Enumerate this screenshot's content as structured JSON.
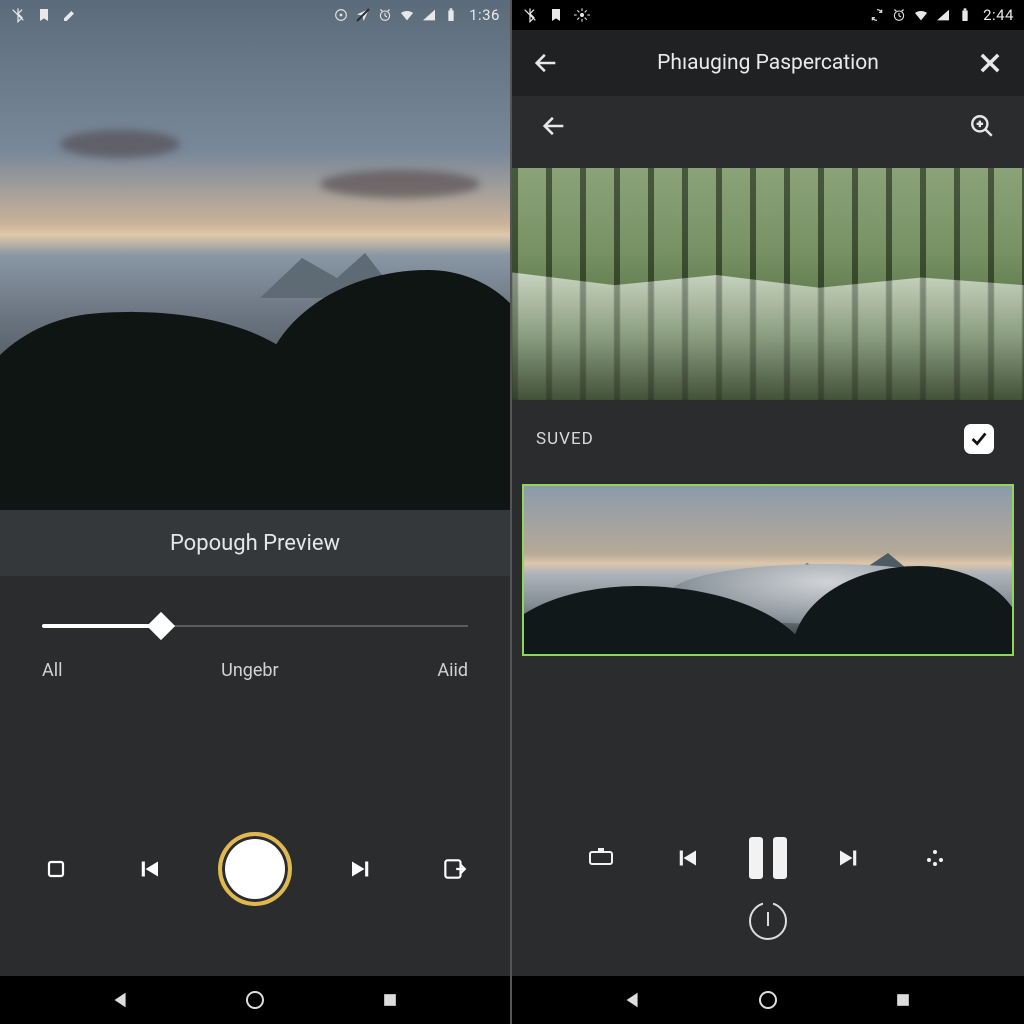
{
  "left": {
    "status": {
      "time": "1:36"
    },
    "panel_title": "Popough Preview",
    "slider": {
      "value_percent": 28,
      "labels": {
        "start": "All",
        "mid": "Ungebr",
        "end": "Aiid"
      }
    }
  },
  "right": {
    "status": {
      "time": "2:44"
    },
    "appbar": {
      "title": "Phıauging Paspercation"
    },
    "saved_label": "SUVED",
    "saved_checked": true
  }
}
